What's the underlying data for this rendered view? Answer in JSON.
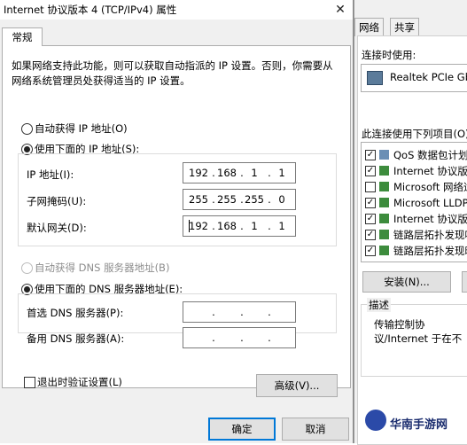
{
  "dialog": {
    "title": "Internet 协议版本 4 (TCP/IPv4) 属性",
    "close_symbol": "✕",
    "tab_label": "常规",
    "intro_text": "如果网络支持此功能，则可以获取自动指派的 IP 设置。否则，你需要从网络系统管理员处获得适当的 IP 设置。",
    "auto_ip_label": "自动获得 IP 地址(O)",
    "manual_ip_label": "使用下面的 IP 地址(S):",
    "ip_address_label": "IP 地址(I):",
    "subnet_label": "子网掩码(U):",
    "gateway_label": "默认网关(D):",
    "ip_address": [
      "192",
      "168",
      "1",
      "1"
    ],
    "subnet_mask": [
      "255",
      "255",
      "255",
      "0"
    ],
    "gateway": [
      "192",
      "168",
      "1",
      "1"
    ],
    "auto_dns_label": "自动获得 DNS 服务器地址(B)",
    "manual_dns_label": "使用下面的 DNS 服务器地址(E):",
    "preferred_dns_label": "首选 DNS 服务器(P):",
    "alternate_dns_label": "备用 DNS 服务器(A):",
    "ip_dot": ".",
    "validate_label": "退出时验证设置(L)",
    "advanced_button": "高级(V)...",
    "ok_button": "确定",
    "cancel_button": "取消"
  },
  "background_window": {
    "tabs": [
      "网络",
      "共享"
    ],
    "connect_using_label": "连接时使用:",
    "adapter_name": "Realtek PCIe GbE",
    "items_label": "此连接使用下列项目(O):",
    "items": [
      {
        "label": "QoS 数据包计划程",
        "checked": true
      },
      {
        "label": "Internet 协议版本",
        "checked": true
      },
      {
        "label": "Microsoft 网络适",
        "checked": false
      },
      {
        "label": "Microsoft LLDP C",
        "checked": true
      },
      {
        "label": "Internet 协议版本",
        "checked": true
      },
      {
        "label": "链路层拓扑发现响",
        "checked": true
      },
      {
        "label": "链路层拓扑发现映",
        "checked": true
      }
    ],
    "install_button": "安装(N)...",
    "description_title": "描述",
    "description_text": "传输控制协议/Internet 于在不同的相互连接的"
  },
  "watermark": "华南手游网",
  "check_mark": "✓",
  "colors": {
    "dialog_bg": "#f0f0f0",
    "accent": "#0078d7",
    "watermark": "#1a2c6e"
  }
}
